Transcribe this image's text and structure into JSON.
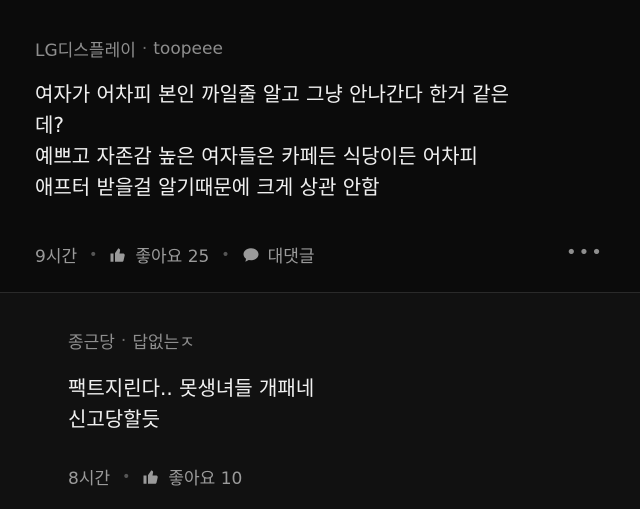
{
  "comment1": {
    "company": "LG디스플레이",
    "nickname": "toopeee",
    "lines": [
      "여자가 어차피 본인 까일줄 알고 그냥 안나간다 한거 같은",
      "데?",
      "예쁘고 자존감 높은 여자들은 카페든 식당이든 어차피",
      "애프터 받을걸 알기때문에 크게 상관 안함"
    ],
    "time": "9시간",
    "like_label": "좋아요 25",
    "reply_label": "대댓글",
    "more_icon": "•••"
  },
  "comment2": {
    "company": "종근당",
    "nickname": "답없는ㅈ",
    "lines": [
      "팩트지린다.. 못생녀들 개패네",
      "신고당할듯"
    ],
    "time": "8시간",
    "like_label": "좋아요 10"
  },
  "separator": "·",
  "colors": {
    "background": "#0b0b0b",
    "reply_background": "#111111",
    "text": "#f0f0f0",
    "muted": "#8e8e8e"
  }
}
